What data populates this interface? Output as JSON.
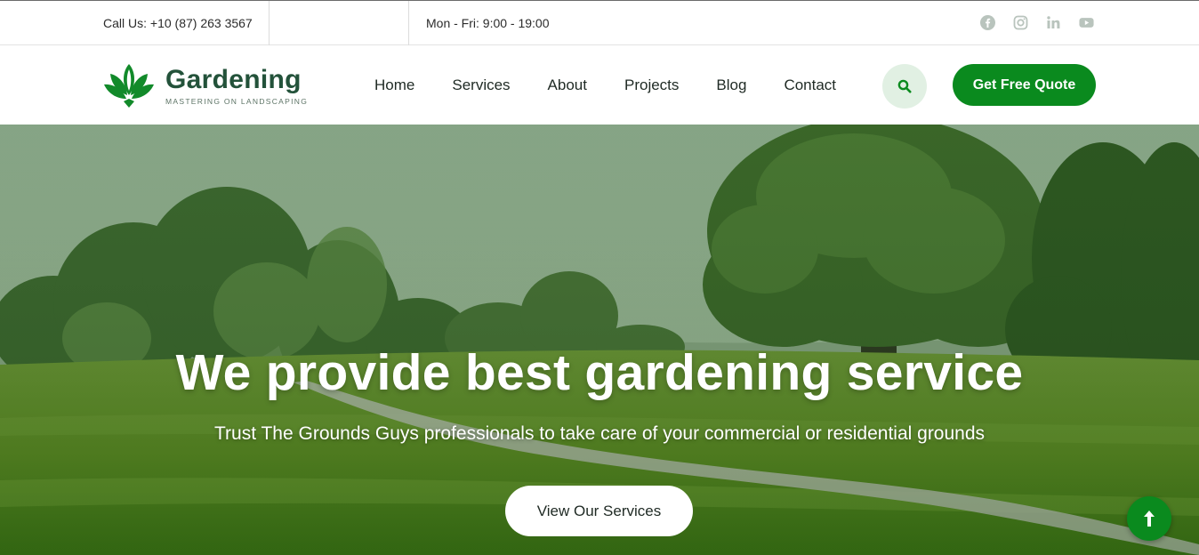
{
  "topbar": {
    "call_text": "Call Us: +10 (87) 263 3567",
    "hours_text": "Mon - Fri: 9:00 - 19:00",
    "socials": [
      "facebook-icon",
      "instagram-icon",
      "linkedin-icon",
      "youtube-icon"
    ]
  },
  "header": {
    "brand": "Gardening",
    "tagline": "MASTERING ON LANDSCAPING",
    "nav": [
      {
        "label": "Home"
      },
      {
        "label": "Services"
      },
      {
        "label": "About"
      },
      {
        "label": "Projects"
      },
      {
        "label": "Blog"
      },
      {
        "label": "Contact"
      }
    ],
    "search_icon": "search-icon",
    "quote_button": "Get Free Quote"
  },
  "hero": {
    "headline": "We provide best gardening service",
    "subheadline": "Trust The Grounds Guys professionals to take care of your commercial or residential grounds",
    "cta": "View Our Services"
  },
  "colors": {
    "accent": "#0a8a1e",
    "brand_text": "#23523a",
    "search_bg": "#e1f0e3",
    "social_icon": "#b9c4bd"
  }
}
